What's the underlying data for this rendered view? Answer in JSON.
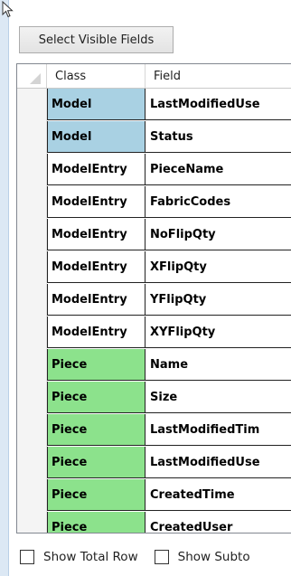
{
  "toolbar": {
    "select_visible_fields_label": "Select Visible Fields"
  },
  "grid": {
    "columns": [
      {
        "label": "Class"
      },
      {
        "label": "Field"
      }
    ],
    "rows": [
      {
        "class": "Model",
        "field": "LastModifiedUse",
        "color": "#a9d1e3"
      },
      {
        "class": "Model",
        "field": "Status",
        "color": "#a9d1e3"
      },
      {
        "class": "ModelEntry",
        "field": "PieceName",
        "color": "#ffffff"
      },
      {
        "class": "ModelEntry",
        "field": "FabricCodes",
        "color": "#ffffff"
      },
      {
        "class": "ModelEntry",
        "field": "NoFlipQty",
        "color": "#ffffff"
      },
      {
        "class": "ModelEntry",
        "field": "XFlipQty",
        "color": "#ffffff"
      },
      {
        "class": "ModelEntry",
        "field": "YFlipQty",
        "color": "#ffffff"
      },
      {
        "class": "ModelEntry",
        "field": "XYFlipQty",
        "color": "#ffffff"
      },
      {
        "class": "Piece",
        "field": "Name",
        "color": "#8ce28c"
      },
      {
        "class": "Piece",
        "field": "Size",
        "color": "#8ce28c"
      },
      {
        "class": "Piece",
        "field": "LastModifiedTim",
        "color": "#8ce28c"
      },
      {
        "class": "Piece",
        "field": "LastModifiedUse",
        "color": "#8ce28c"
      },
      {
        "class": "Piece",
        "field": "CreatedTime",
        "color": "#8ce28c"
      },
      {
        "class": "Piece",
        "field": "CreatedUser",
        "color": "#8ce28c"
      }
    ]
  },
  "footer": {
    "show_total_row_label": "Show Total Row",
    "show_total_row_checked": false,
    "show_subtotals_label": "Show Subto",
    "show_subtotals_checked": false
  }
}
